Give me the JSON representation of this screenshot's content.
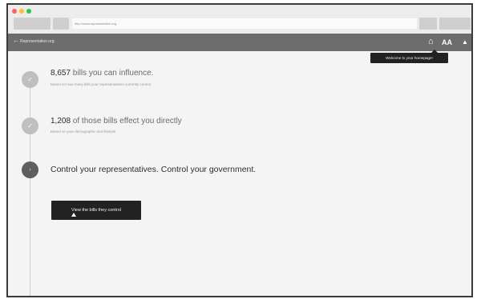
{
  "browser": {
    "url": "http://www.representation.org",
    "traffic_light_colors": [
      "#ff5f57",
      "#ffbd2e",
      "#28c840"
    ]
  },
  "appbar": {
    "back_icon": "←",
    "site_name": "Representation.org",
    "home_icon": "⌂",
    "text_size_icon": "AA",
    "bell_icon": "🔔"
  },
  "tooltip": {
    "text": "Welcome to your homepage!"
  },
  "steps": [
    {
      "number": "8,657",
      "headline": " bills you can influence.",
      "subtext": "Based on how many bills your representatives currently control."
    },
    {
      "number": "1,208",
      "headline": " of those bills effect you directly",
      "subtext": "Based on your demographic and lifestyle"
    },
    {
      "text": "Control your representatives. Control your government."
    }
  ],
  "cta": {
    "label": "View the bills they control"
  }
}
